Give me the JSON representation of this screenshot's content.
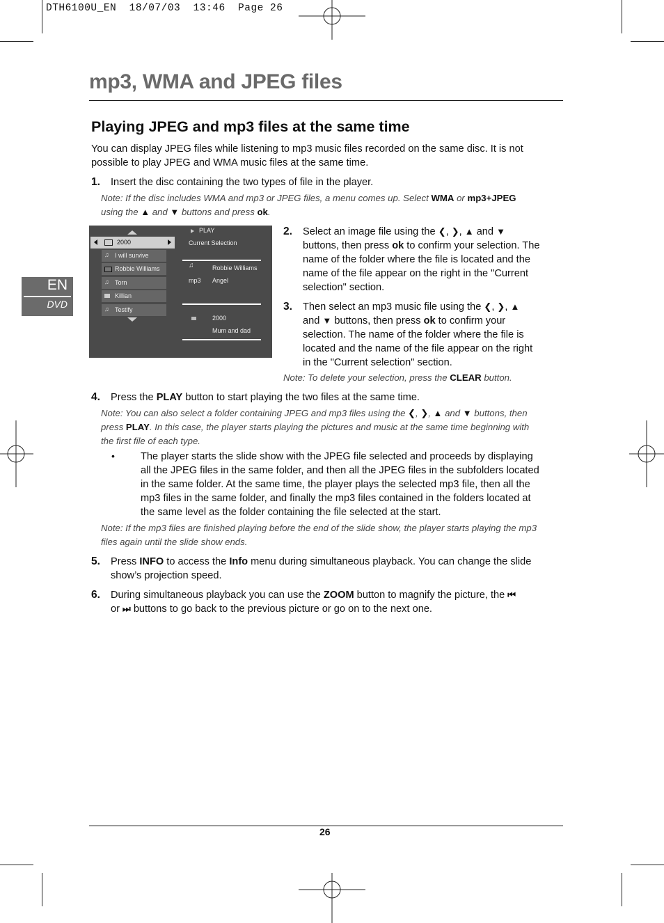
{
  "slug": "DTH6100U_EN  18/07/03  13:46  Page 26",
  "title": "mp3, WMA and JPEG files",
  "section_heading": "Playing JPEG and mp3 files at the same time",
  "intro": {
    "line1": "You can display JPEG files while listening to mp3 music files recorded on the same disc. It is not",
    "line2": "possible to play JPEG and WMA music files at the same time."
  },
  "side_tab": {
    "lang": "EN",
    "product": "DVD"
  },
  "step1": {
    "num": "1.",
    "text": "Insert the disc containing the two types of file in the player.",
    "note_a": "Note: If the disc includes WMA and mp3 or JPEG files, a menu comes up. Select ",
    "note_wma": "WMA",
    "note_or": " or ",
    "note_mp3jpeg": "mp3+JPEG",
    "note_b": "using the ",
    "note_and": " and ",
    "note_c": " buttons and press ",
    "note_ok": "ok",
    "note_end": "."
  },
  "osd": {
    "folder": "2000",
    "items": [
      {
        "icon": "music-note",
        "label": "I will survive"
      },
      {
        "icon": "folder",
        "label": "Robbie Williams"
      },
      {
        "icon": "music-note",
        "label": "Torn"
      },
      {
        "icon": "camera",
        "label": "Killian"
      },
      {
        "icon": "music-note",
        "label": "Testify"
      }
    ],
    "play_label": "PLAY",
    "current_selection_label": "Current Selection",
    "music_selection": {
      "type_label": "mp3",
      "folder": "Robbie Williams",
      "file": "Angel"
    },
    "image_selection": {
      "folder": "2000",
      "file": "Mum and dad"
    }
  },
  "step2": {
    "num": "2.",
    "lines": [
      "Select an image file using the",
      "buttons, then press",
      "to confirm your selection. The",
      "name of the folder where the file is located and the",
      "name of the file appear on the right in the \"Current",
      "selection\" section."
    ],
    "ok": "ok",
    "and": "and"
  },
  "step3": {
    "num": "3.",
    "lines": [
      "Then select an mp3 music file using the",
      "and",
      "buttons, then press",
      "to confirm your",
      "selection. The name of the folder where the file is",
      "located and the name of the file appear on the right",
      "in the \"Current selection\" section."
    ],
    "ok": "ok",
    "note_a": "Note: To delete your selection, press the ",
    "note_clear": "CLEAR",
    "note_b": " button."
  },
  "step4": {
    "num": "4.",
    "text_a": "Press the ",
    "text_play": "PLAY",
    "text_b": " button to start playing the two files at the same time.",
    "note1_a": "Note: You can also select a folder containing JPEG and mp3 files using the ",
    "note1_and": " and ",
    "note1_b": " buttons, then",
    "note2_a": "press ",
    "note2_play": "PLAY",
    "note2_b": ". In this case, the player starts playing the pictures and music at the same time beginning with",
    "note3": "the first file of each type.",
    "bullet": "•",
    "bullet_lines": [
      "The player starts the slide show with the JPEG file selected and proceeds by displaying",
      "all the JPEG files in the same folder, and then all the JPEG files in the subfolders located",
      "in the same folder. At the same time, the player plays the selected mp3 file, then all the",
      "mp3 files in the same folder, and finally the mp3 files contained in the folders located at",
      "the same level as the folder containing the file selected at the start."
    ],
    "note4_l1": "Note: If the mp3 files are finished playing before the end of the slide show, the player starts playing the mp3",
    "note4_l2": "files again until the slide show ends."
  },
  "step5": {
    "num": "5.",
    "a": "Press ",
    "info_btn": "INFO",
    "b": " to access the ",
    "info_menu": "Info",
    "c": " menu during simultaneous playback. You can change the slide",
    "line2": "show’s projection speed."
  },
  "step6": {
    "num": "6.",
    "a": "During simultaneous playback you can use the ",
    "zoom": "ZOOM",
    "b": " button to magnify the picture, the",
    "or": "or",
    "line2": "buttons to go back to the previous picture or go on to the next one."
  },
  "glyphs": {
    "left": "❮",
    "right": "❯",
    "up": "▲",
    "down": "▼",
    "prev": "⏮",
    "next": "⏭",
    "comma": ", "
  },
  "page_number": "26"
}
